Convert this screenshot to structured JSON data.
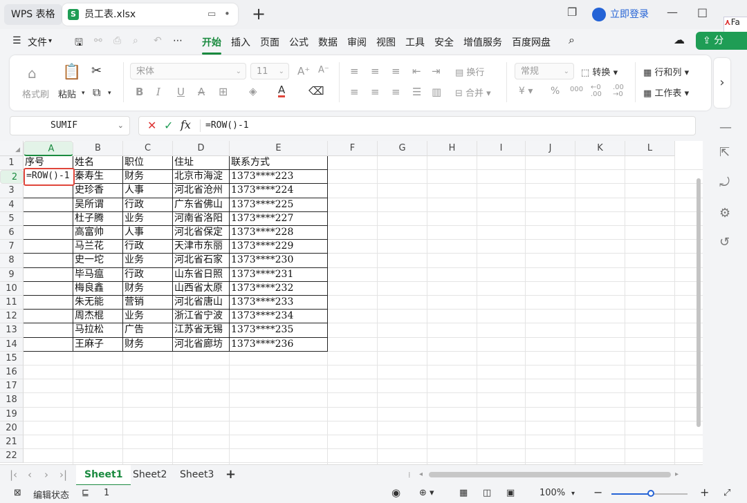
{
  "titlebar": {
    "app_tab": "WPS 表格",
    "file_tab": "员工表.xlsx",
    "file_icon_letter": "S",
    "login": "立即登录",
    "fa_label": "Fa"
  },
  "menus": [
    "文件",
    "开始",
    "插入",
    "页面",
    "公式",
    "数据",
    "审阅",
    "视图",
    "工具",
    "安全",
    "增值服务",
    "百度网盘"
  ],
  "active_menu": "开始",
  "share_label": "分",
  "ribbon": {
    "format_painter": "格式刷",
    "paste": "粘贴",
    "font_name": "宋体",
    "font_size": "11",
    "wrap": "换行",
    "merge": "合并",
    "number_format": "常规",
    "convert": "转换",
    "rows_cols": "行和列",
    "worksheet": "工作表",
    "bold": "B",
    "italic": "I",
    "underline": "U",
    "strike": "A",
    "font_color": "A",
    "currency": "¥",
    "percent": "%"
  },
  "formula_bar": {
    "name_box": "SUMIF",
    "formula": "=ROW()-1"
  },
  "columns": [
    "A",
    "B",
    "C",
    "D",
    "E",
    "F",
    "G",
    "H",
    "I",
    "J",
    "K",
    "L"
  ],
  "selected_column": "A",
  "rows": [
    "1",
    "2",
    "3",
    "4",
    "5",
    "6",
    "7",
    "8",
    "9",
    "10",
    "11",
    "12",
    "13",
    "14",
    "15",
    "16",
    "17",
    "18",
    "19",
    "20",
    "21",
    "22"
  ],
  "selected_row": "2",
  "table": {
    "headers": [
      "序号",
      "姓名",
      "职位",
      "住址",
      "联系方式"
    ],
    "editing_cell_text": "=ROW()-1",
    "records": [
      [
        "秦寿生",
        "财务",
        "北京市海淀",
        "1373****223"
      ],
      [
        "史珍香",
        "人事",
        "河北省沧州",
        "1373****224"
      ],
      [
        "吴所谓",
        "行政",
        "广东省佛山",
        "1373****225"
      ],
      [
        "杜子腾",
        "业务",
        "河南省洛阳",
        "1373****227"
      ],
      [
        "高富帅",
        "人事",
        "河北省保定",
        "1373****228"
      ],
      [
        "马兰花",
        "行政",
        "天津市东丽",
        "1373****229"
      ],
      [
        "史一坨",
        "业务",
        "河北省石家",
        "1373****230"
      ],
      [
        "毕马瘟",
        "行政",
        "山东省日照",
        "1373****231"
      ],
      [
        "梅良鑫",
        "财务",
        "山西省太原",
        "1373****232"
      ],
      [
        "朱无能",
        "营销",
        "河北省唐山",
        "1373****233"
      ],
      [
        "周杰棍",
        "业务",
        "浙江省宁波",
        "1373****234"
      ],
      [
        "马拉松",
        "广告",
        "江苏省无锡",
        "1373****235"
      ],
      [
        "王麻子",
        "财务",
        "河北省廊坊",
        "1373****236"
      ]
    ]
  },
  "sheets": [
    "Sheet1",
    "Sheet2",
    "Sheet3"
  ],
  "active_sheet": "Sheet1",
  "statusbar": {
    "mode": "编辑状态",
    "count": "1",
    "zoom": "100%",
    "zoom_fraction": 0.5
  }
}
